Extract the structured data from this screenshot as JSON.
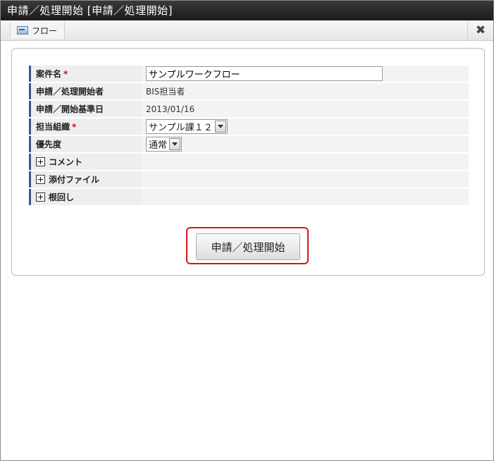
{
  "window": {
    "title": "申請／処理開始 [申請／処理開始]"
  },
  "toolbar": {
    "tab_label": "フロー",
    "close_symbol": "✖"
  },
  "form": {
    "fields": [
      {
        "label": "案件名",
        "required": "*",
        "value": "サンプルワークフロー"
      },
      {
        "label": "申請／処理開始者",
        "value": "BIS担当者"
      },
      {
        "label": "申請／開始基準日",
        "value": "2013/01/16"
      },
      {
        "label": "担当組織",
        "required": "*",
        "value": "サンプル課１２"
      },
      {
        "label": "優先度",
        "value": "通常"
      }
    ],
    "sections": [
      {
        "label": "コメント"
      },
      {
        "label": "添付ファイル"
      },
      {
        "label": "根回し"
      }
    ]
  },
  "submit": {
    "label": "申請／処理開始"
  },
  "colors": {
    "highlight_border": "#d21a1a",
    "label_accent": "#3a5a8c"
  }
}
